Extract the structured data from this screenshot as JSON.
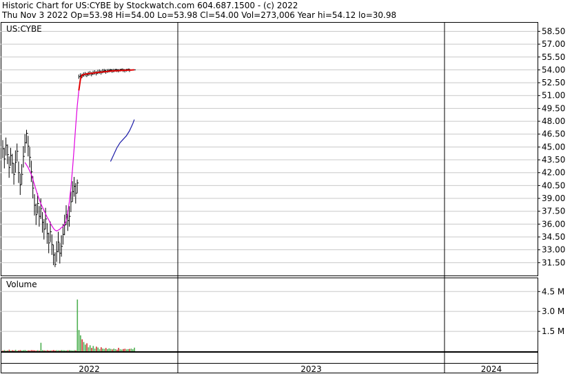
{
  "header": {
    "line1": "Historic Chart for US:CYBE by Stockwatch.com 604.687.1500 - (c) 2022",
    "line2": "Thu Nov  3 2022   Op=53.98  Hi=54.00  Lo=53.98  Cl=54.00  Vol=273,006  Year hi=54.12  lo=30.98"
  },
  "colors": {
    "price_bar": "#000000",
    "ma_short": "#e000e0",
    "ma_long": "#1a1aa8",
    "highlight": "#e00000",
    "volume_up": "#4caf50",
    "volume_down": "#d32f2f",
    "grid": "#c8c8c8"
  },
  "chart_data": {
    "type": "ohlc",
    "symbol_label": "US:CYBE",
    "price_axis": {
      "ticks": [
        "58.50",
        "57.00",
        "55.50",
        "54.00",
        "52.50",
        "51.00",
        "49.50",
        "48.00",
        "46.50",
        "45.00",
        "43.50",
        "42.00",
        "40.50",
        "39.00",
        "37.50",
        "36.00",
        "34.50",
        "33.00",
        "31.50"
      ],
      "ylim": [
        30.0,
        59.5
      ]
    },
    "volume_panel": {
      "label": "Volume",
      "ticks": [
        "4.5 M",
        "3.0 M",
        "1.5 M"
      ],
      "ylim": [
        0,
        5500000
      ]
    },
    "time_axis": {
      "years": [
        "2022",
        "2023",
        "2024"
      ]
    },
    "close_prices": [
      44.8,
      43.6,
      45.2,
      44.1,
      42.6,
      44.0,
      43.1,
      41.8,
      43.2,
      44.5,
      42.0,
      40.6,
      41.8,
      43.9,
      45.5,
      46.6,
      45.1,
      43.8,
      42.1,
      40.2,
      38.2,
      37.1,
      38.4,
      36.9,
      37.8,
      36.2,
      35.4,
      36.6,
      34.9,
      33.8,
      35.1,
      33.6,
      32.4,
      31.3,
      32.8,
      33.9,
      32.6,
      33.4,
      34.8,
      35.9,
      37.1,
      36.4,
      36.9,
      38.6,
      39.8,
      40.4,
      39.6,
      40.8,
      53.2,
      53.35,
      53.3,
      53.45,
      53.5,
      53.4,
      53.55,
      53.6,
      53.5,
      53.65,
      53.7,
      53.6,
      53.75,
      53.8,
      53.7,
      53.85,
      53.9,
      53.8,
      53.9,
      53.95,
      54.0,
      53.9,
      53.95,
      54.05,
      54.0,
      53.95,
      54.05,
      54.1,
      54.0,
      53.95,
      54.05,
      54.1,
      54.0,
      53.98,
      54.0,
      54.0
    ],
    "highs": [
      45.8,
      44.9,
      46.1,
      45.3,
      43.9,
      44.9,
      44.2,
      43.1,
      44.6,
      45.4,
      43.3,
      41.9,
      43.0,
      45.1,
      46.5,
      47.0,
      46.3,
      45.0,
      43.4,
      41.6,
      39.5,
      38.4,
      39.6,
      38.1,
      39.0,
      37.4,
      36.6,
      37.9,
      36.1,
      35.0,
      36.3,
      34.8,
      33.6,
      32.7,
      34.0,
      35.1,
      33.8,
      34.7,
      36.0,
      37.1,
      38.2,
      37.6,
      38.1,
      39.8,
      41.0,
      41.5,
      40.8,
      41.2,
      53.45,
      53.6,
      53.55,
      53.7,
      53.75,
      53.65,
      53.8,
      53.85,
      53.75,
      53.9,
      53.95,
      53.85,
      54.0,
      54.05,
      53.95,
      54.1,
      54.12,
      54.05,
      54.1,
      54.12,
      54.12,
      54.1,
      54.12,
      54.12,
      54.12,
      54.1,
      54.12,
      54.12,
      54.12,
      54.1,
      54.12,
      54.12,
      54.12,
      54.05,
      54.05,
      54.0
    ],
    "lows": [
      43.7,
      42.5,
      44.0,
      43.0,
      41.4,
      42.8,
      41.9,
      40.6,
      42.0,
      43.3,
      40.8,
      39.4,
      40.6,
      42.6,
      44.3,
      45.4,
      43.9,
      42.6,
      40.9,
      39.0,
      37.0,
      35.9,
      37.2,
      35.7,
      36.6,
      35.0,
      34.2,
      35.4,
      33.7,
      32.6,
      33.9,
      32.4,
      31.2,
      30.98,
      31.6,
      32.7,
      31.4,
      32.2,
      33.6,
      34.7,
      35.9,
      35.2,
      35.7,
      37.4,
      38.6,
      39.2,
      38.4,
      39.6,
      52.95,
      53.1,
      53.05,
      53.2,
      53.25,
      53.15,
      53.3,
      53.35,
      53.25,
      53.4,
      53.45,
      53.35,
      53.5,
      53.55,
      53.45,
      53.6,
      53.65,
      53.55,
      53.65,
      53.7,
      53.75,
      53.65,
      53.7,
      53.8,
      53.75,
      53.7,
      53.8,
      53.85,
      53.75,
      53.7,
      53.8,
      53.85,
      53.75,
      53.98,
      53.98,
      53.98
    ],
    "ma_short": [
      null,
      null,
      null,
      null,
      null,
      null,
      null,
      null,
      null,
      null,
      null,
      null,
      null,
      null,
      43.2,
      42.9,
      42.6,
      42.2,
      41.8,
      41.2,
      40.6,
      40.0,
      39.4,
      38.9,
      38.4,
      38.0,
      37.6,
      37.2,
      36.8,
      36.5,
      36.1,
      35.8,
      35.5,
      35.3,
      35.2,
      35.3,
      35.4,
      35.6,
      35.7,
      36.0,
      36.4,
      37.3,
      38.6,
      40.3,
      42.4,
      44.8,
      47.4,
      49.8,
      51.6,
      52.9,
      53.4,
      53.45,
      53.5,
      53.52,
      53.55,
      53.58,
      53.6,
      53.62,
      53.65,
      53.67,
      53.7,
      53.72,
      53.74,
      53.76,
      53.78,
      53.8,
      53.82,
      53.84,
      53.86,
      53.87,
      53.88,
      53.89,
      53.9,
      53.91,
      53.92,
      53.93,
      53.94,
      53.95,
      53.96,
      53.97,
      53.98,
      53.98,
      53.99,
      54.0
    ],
    "ma_long": [
      null,
      null,
      null,
      null,
      null,
      null,
      null,
      null,
      null,
      null,
      null,
      null,
      null,
      null,
      null,
      null,
      null,
      null,
      null,
      null,
      null,
      null,
      null,
      null,
      null,
      null,
      null,
      null,
      null,
      null,
      null,
      null,
      null,
      null,
      null,
      null,
      null,
      null,
      null,
      null,
      null,
      null,
      null,
      null,
      null,
      null,
      null,
      null,
      null,
      null,
      null,
      null,
      null,
      null,
      null,
      null,
      null,
      null,
      null,
      null,
      null,
      null,
      null,
      null,
      null,
      null,
      null,
      null,
      43.3,
      43.7,
      44.1,
      44.5,
      44.9,
      45.2,
      45.5,
      45.7,
      45.9,
      46.1,
      46.3,
      46.6,
      46.9,
      47.3,
      47.7,
      48.2
    ],
    "volume": [
      60000,
      90000,
      40000,
      70000,
      120000,
      50000,
      80000,
      60000,
      110000,
      40000,
      70000,
      90000,
      60000,
      80000,
      100000,
      50000,
      70000,
      60000,
      90000,
      80000,
      70000,
      60000,
      80000,
      50000,
      640000,
      90000,
      70000,
      60000,
      80000,
      50000,
      60000,
      70000,
      90000,
      60000,
      80000,
      70000,
      60000,
      90000,
      80000,
      70000,
      60000,
      80000,
      90000,
      70000,
      60000,
      80000,
      70000,
      3900000,
      1600000,
      1200000,
      900000,
      700000,
      500000,
      600000,
      300000,
      450000,
      250000,
      400000,
      200000,
      350000,
      280000,
      150000,
      300000,
      200000,
      180000,
      250000,
      160000,
      220000,
      180000,
      140000,
      200000,
      160000,
      120000,
      260000,
      150000,
      130000,
      170000,
      190000,
      140000,
      160000,
      180000,
      200000,
      150000,
      273006
    ],
    "volume_up": [
      false,
      true,
      false,
      true,
      false,
      true,
      false,
      false,
      true,
      true,
      false,
      false,
      true,
      true,
      true,
      true,
      false,
      false,
      false,
      false,
      false,
      false,
      true,
      false,
      true,
      true,
      false,
      true,
      false,
      false,
      true,
      false,
      false,
      false,
      true,
      true,
      false,
      true,
      true,
      true,
      true,
      false,
      true,
      true,
      true,
      true,
      false,
      true,
      true,
      true,
      false,
      true,
      true,
      false,
      true,
      true,
      false,
      true,
      true,
      false,
      true,
      true,
      false,
      true,
      true,
      false,
      true,
      true,
      true,
      false,
      true,
      true,
      false,
      false,
      true,
      true,
      false,
      false,
      true,
      true,
      false,
      true,
      true,
      true
    ]
  }
}
